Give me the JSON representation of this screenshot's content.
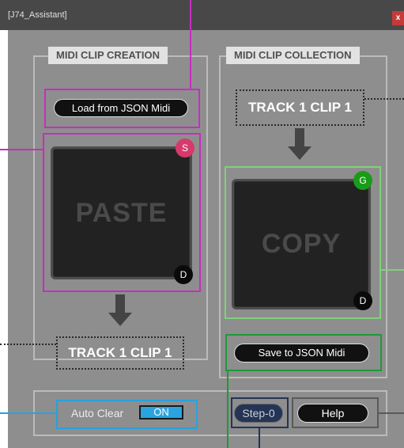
{
  "window": {
    "title": "[J74_Assistant]",
    "close_label": "x"
  },
  "creation": {
    "title": "MIDI CLIP CREATION",
    "load_button": "Load from JSON Midi",
    "pad_label": "PASTE",
    "s_button": "S",
    "d_button": "D",
    "target_track": "TRACK 1 CLIP 1"
  },
  "collection": {
    "title": "MIDI CLIP COLLECTION",
    "source_track": "TRACK 1 CLIP 1",
    "pad_label": "COPY",
    "g_button": "G",
    "d_button": "D",
    "save_button": "Save to JSON Midi"
  },
  "footer": {
    "auto_clear_label": "Auto Clear",
    "auto_clear_value": "ON",
    "step_button": "Step-0",
    "help_button": "Help"
  },
  "colors": {
    "magenta_highlight": "#c62ec1",
    "cyan_highlight": "#26a2de",
    "light_green_highlight": "#7fd17b",
    "green_highlight": "#1c9a3a",
    "navy_highlight": "#233456",
    "s_button_color": "#d63a6d",
    "g_button_color": "#1a9b1a",
    "on_toggle_color": "#2aa3df"
  }
}
